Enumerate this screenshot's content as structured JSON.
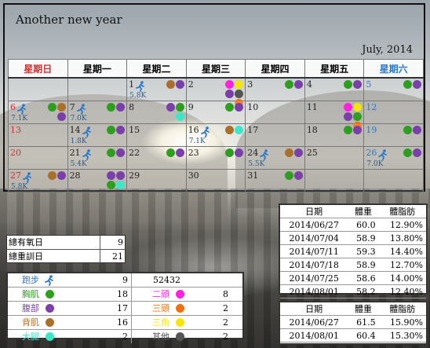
{
  "title": "Another new year",
  "month": "July, 2014",
  "colors": {
    "chest": "#2e9e1f",
    "abs": "#7a3fa8",
    "back": "#a8702a",
    "legs": "#3ee6c8",
    "biceps": "#ff22dd",
    "triceps": "#f07010",
    "shoulders": "#f5e60a",
    "other": "#555555",
    "sunday": "#d23030",
    "saturday": "#2a78c8"
  },
  "weekdays": [
    "星期日",
    "星期一",
    "星期二",
    "星期三",
    "星期四",
    "星期五",
    "星期六"
  ],
  "weeks": [
    [
      {
        "day": "",
        "run": "",
        "dots": []
      },
      {
        "day": "",
        "run": "",
        "dots": []
      },
      {
        "day": "1",
        "run": "5.8K",
        "dots": [
          "back",
          "abs"
        ]
      },
      {
        "day": "2",
        "run": "",
        "dots": [
          "biceps",
          "shoulders",
          "abs",
          "other",
          "triceps"
        ]
      },
      {
        "day": "3",
        "run": "",
        "dots": [
          "chest",
          "abs"
        ]
      },
      {
        "day": "4",
        "run": "",
        "dots": [
          "chest",
          "abs"
        ]
      },
      {
        "day": "5",
        "run": "",
        "dots": [
          "chest",
          "abs"
        ]
      }
    ],
    [
      {
        "day": "6",
        "run": "7.1K",
        "dots": [
          "chest",
          "back",
          "abs"
        ]
      },
      {
        "day": "7",
        "run": "7.0K",
        "dots": [
          "chest",
          "abs"
        ]
      },
      {
        "day": "8",
        "run": "",
        "dots": [
          "abs",
          "chest",
          "legs"
        ]
      },
      {
        "day": "9",
        "run": "",
        "dots": [
          "chest",
          "abs"
        ]
      },
      {
        "day": "10",
        "run": "",
        "dots": []
      },
      {
        "day": "11",
        "run": "",
        "dots": [
          "biceps",
          "shoulders",
          "abs",
          "chest",
          "triceps"
        ]
      },
      {
        "day": "12",
        "run": "",
        "dots": []
      }
    ],
    [
      {
        "day": "13",
        "run": "",
        "dots": []
      },
      {
        "day": "14",
        "run": "1.8K",
        "dots": [
          "chest",
          "abs"
        ]
      },
      {
        "day": "15",
        "run": "",
        "dots": []
      },
      {
        "day": "16",
        "run": "7.1K",
        "dots": [
          "back",
          "legs"
        ]
      },
      {
        "day": "17",
        "run": "",
        "dots": []
      },
      {
        "day": "18",
        "run": "",
        "dots": [
          "chest",
          "abs"
        ]
      },
      {
        "day": "19",
        "run": "",
        "dots": [
          "chest",
          "abs"
        ]
      }
    ],
    [
      {
        "day": "20",
        "run": "",
        "dots": []
      },
      {
        "day": "21",
        "run": "5.4K",
        "dots": [
          "chest",
          "abs"
        ]
      },
      {
        "day": "22",
        "run": "",
        "dots": [
          "chest",
          "abs"
        ]
      },
      {
        "day": "23",
        "run": "",
        "dots": [
          "chest",
          "abs"
        ]
      },
      {
        "day": "24",
        "run": "5.5K",
        "dots": [
          "back",
          "abs"
        ]
      },
      {
        "day": "25",
        "run": "",
        "dots": []
      },
      {
        "day": "26",
        "run": "7.0K",
        "dots": [
          "chest",
          "abs"
        ]
      }
    ],
    [
      {
        "day": "27",
        "run": "5.8K",
        "dots": [
          "back",
          "abs"
        ]
      },
      {
        "day": "28",
        "run": "",
        "dots": [
          "abs",
          "abs",
          "chest",
          "legs"
        ]
      },
      {
        "day": "29",
        "run": "",
        "dots": []
      },
      {
        "day": "30",
        "run": "",
        "dots": []
      },
      {
        "day": "31",
        "run": "",
        "dots": [
          "chest",
          "abs"
        ]
      },
      {
        "day": "",
        "run": "",
        "dots": []
      },
      {
        "day": "",
        "run": "",
        "dots": []
      }
    ]
  ],
  "totals": {
    "aerobic_label": "總有氧日",
    "aerobic_value": "9",
    "weight_label": "總重訓日",
    "weight_value": "21"
  },
  "legend": {
    "run_label": "跑步",
    "run_count": "9",
    "run_distance": "52432",
    "rows": [
      {
        "left_label": "胸肌",
        "left_color": "chest",
        "left_value": "18",
        "right_label": "二頭",
        "right_color": "biceps",
        "right_value": "8"
      },
      {
        "left_label": "腹部",
        "left_color": "abs",
        "left_value": "17",
        "right_label": "三頭",
        "right_color": "triceps",
        "right_value": "2"
      },
      {
        "left_label": "背肌",
        "left_color": "back",
        "left_value": "16",
        "right_label": "三角",
        "right_color": "shoulders",
        "right_value": "2"
      },
      {
        "left_label": "大腿",
        "left_color": "legs",
        "left_value": "2",
        "right_label": "其他",
        "right_color": "other",
        "right_value": "2"
      }
    ]
  },
  "weights": {
    "headers": [
      "日期",
      "體重",
      "體脂肪"
    ],
    "rows": [
      [
        "2014/06/27",
        "60.0",
        "12.90%"
      ],
      [
        "2014/07/04",
        "58.9",
        "13.80%"
      ],
      [
        "2014/07/11",
        "59.3",
        "14.40%"
      ],
      [
        "2014/07/18",
        "58.9",
        "12.70%"
      ],
      [
        "2014/07/25",
        "58.6",
        "14.00%"
      ],
      [
        "2014/08/01",
        "58.2",
        "12.40%"
      ]
    ]
  },
  "weights2": {
    "headers": [
      "日期",
      "體重",
      "體脂肪"
    ],
    "rows": [
      [
        "2014/06/27",
        "61.5",
        "15.90%"
      ],
      [
        "2014/08/01",
        "60.4",
        "15.30%"
      ]
    ]
  }
}
